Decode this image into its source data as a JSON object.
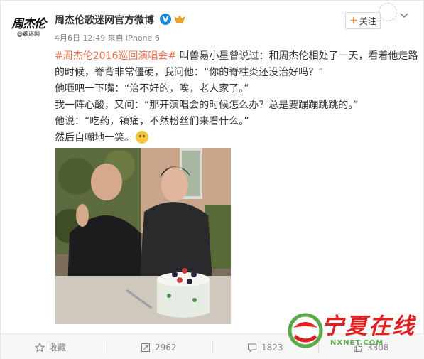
{
  "header": {
    "avatar_logo_main": "周杰伦",
    "avatar_logo_sub": "@歌迷网",
    "username": "周杰伦歌迷网官方微博",
    "meta": "4月6日 12:49 来自 iPhone 6",
    "follow_label": "关注"
  },
  "post": {
    "hashtag": "#周杰伦2016巡回演唱会#",
    "lines": [
      " 叫兽易小星曾说过：和周杰伦相处了一天，看着他走路",
      "的时候，脊背非常僵硬，我问他：“你的脊柱炎还没治好吗？”",
      "他咂吧一下嘴：“治不好的，唉，老人家了。”",
      "我一阵心酸，又问：“那开演唱会的时候怎么办？总是要蹦蹦跳跳的。”",
      "他说：“吃药，镇痛，不然粉丝们来看什么。”",
      "然后自嘲地一笑。"
    ]
  },
  "actions": {
    "favorite_label": "收藏",
    "repost_count": "2962",
    "comment_count": "1823",
    "like_count": "3308"
  },
  "watermark": {
    "text": "宁夏在线",
    "url": "NXNET.COM"
  },
  "colors": {
    "hashtag": "#eb7350",
    "verified": "#1f8ad9",
    "watermark_red": "#e02020",
    "watermark_green": "#5aaa4a"
  },
  "icons": [
    "verified-icon",
    "vip-icon",
    "chevron-down-icon",
    "star-icon",
    "repost-icon",
    "comment-icon",
    "like-icon",
    "laugh-cry-emoji"
  ]
}
